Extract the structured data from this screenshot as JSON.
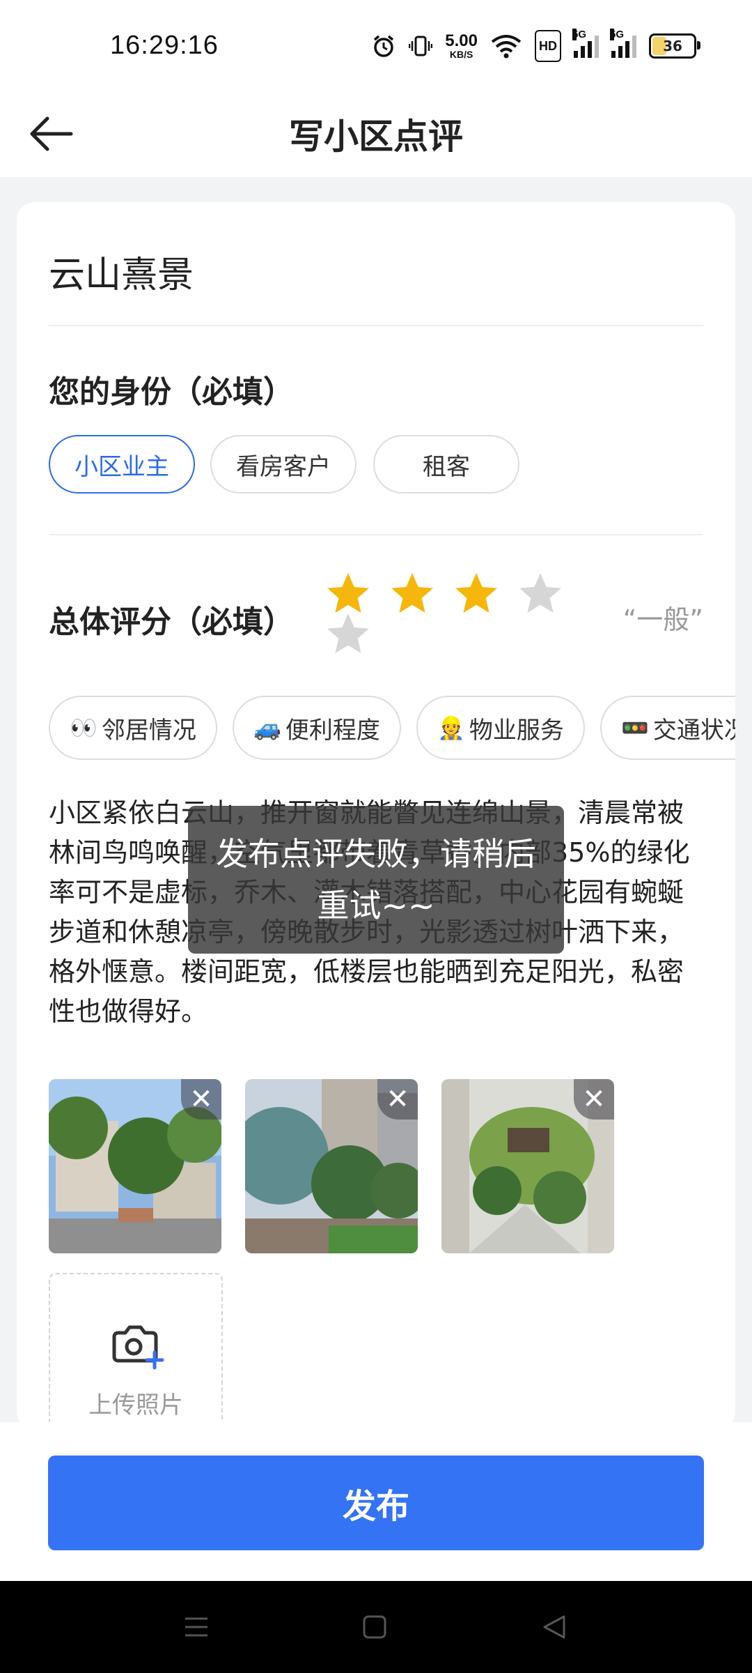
{
  "status_bar": {
    "time": "16:29:16",
    "net_speed_value": "5.00",
    "net_speed_unit": "KB/S",
    "hd_label": "HD",
    "signal1_label": "5G",
    "signal2_label": "5G",
    "battery_level": "36",
    "icons": [
      "alarm-icon",
      "vibrate-icon",
      "wifi-icon",
      "hd-icon",
      "signal-icon",
      "signal-icon",
      "battery-icon"
    ]
  },
  "header": {
    "title": "写小区点评",
    "back_icon": "arrow-left-icon"
  },
  "form": {
    "community_name": "云山熹景",
    "identity_label": "您的身份（必填）",
    "identity_options": [
      "小区业主",
      "看房客户",
      "租客"
    ],
    "identity_selected": "小区业主",
    "rating_label": "总体评分（必填）",
    "rating_value": 3,
    "rating_max": 5,
    "rating_text": "“一般”",
    "tags": [
      {
        "emoji": "👀",
        "label": "邻居情况"
      },
      {
        "emoji": "🚙",
        "label": "便利程度"
      },
      {
        "emoji": "👷",
        "label": "物业服务"
      },
      {
        "emoji": "🚥",
        "label": "交通状况"
      }
    ],
    "review_text": "小区紧依白云山，推开窗就能瞥见连绵山景，清晨常被林间鸟鸣唤醒，空气里都带着青草香。内部35%的绿化率可不是虚标，乔木、灌木错落搭配，中心花园有蜿蜒步道和休憩凉亭，傍晚散步时，光影透过树叶洒下来，格外惬意。楼间距宽，低楼层也能晒到充足阳光，私密性也做得好。",
    "photo_close_symbol": "✕",
    "upload_label": "上传照片"
  },
  "actions": {
    "publish_label": "发布"
  },
  "toast": {
    "message": "发布点评失败，请稍后重试~~"
  },
  "colors": {
    "accent": "#3473f4",
    "star_active": "#f5b70b",
    "star_inactive": "#d6d6d6"
  }
}
